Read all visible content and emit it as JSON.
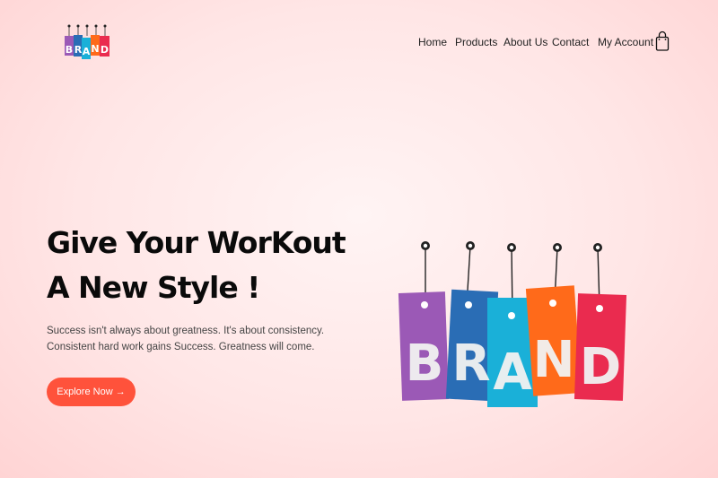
{
  "brand": {
    "logo_letters": [
      "B",
      "R",
      "A",
      "N",
      "D"
    ],
    "tag_colors": [
      "#9b59b6",
      "#2a6db5",
      "#1ab0d8",
      "#ff6a1a",
      "#ea2b4f"
    ]
  },
  "nav": {
    "items": [
      {
        "label": "Home"
      },
      {
        "label": "Products"
      },
      {
        "label": "About Us"
      },
      {
        "label": "Contact"
      },
      {
        "label": "My Account"
      }
    ],
    "cart_icon": "shopping-bag-icon"
  },
  "hero": {
    "title_line1": "Give Your WorKout",
    "title_line2": "A New Style !",
    "description": "Success isn't always about greatness. It's about consistency. Consistent hard work gains Success. Greatness will come.",
    "cta_label": "Explore Now →"
  },
  "colors": {
    "accent": "#ff523b",
    "background": "#ffe4e4"
  }
}
